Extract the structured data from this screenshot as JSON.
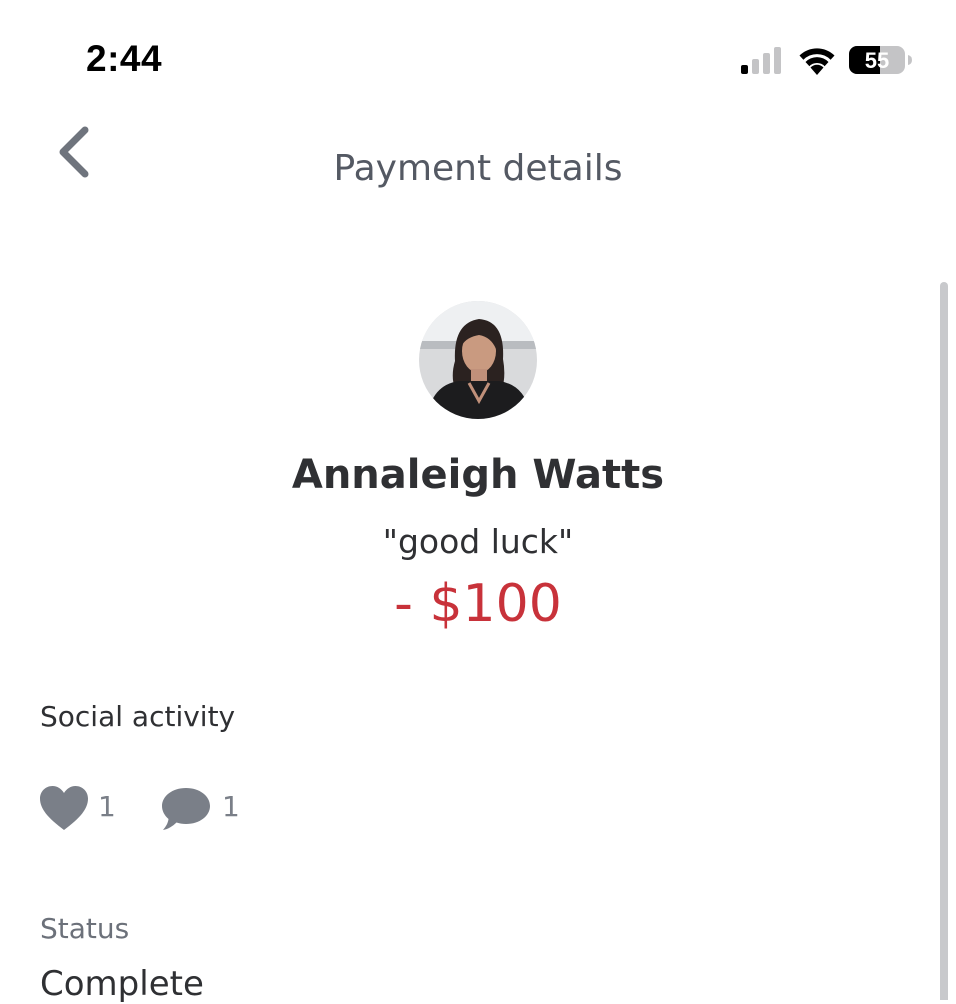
{
  "status_bar": {
    "time": "2:44",
    "battery_level": "55",
    "signal_icon": "cellular-signal-icon",
    "wifi_icon": "wifi-icon",
    "battery_icon": "battery-icon"
  },
  "header": {
    "title": "Payment details",
    "back_icon": "chevron-left-icon"
  },
  "payment": {
    "user_name": "Annaleigh Watts",
    "note": "\"good luck\"",
    "amount": "- $100",
    "amount_color": "#c8323a"
  },
  "social": {
    "label": "Social activity",
    "likes": "1",
    "comments": "1",
    "like_icon": "heart-icon",
    "comment_icon": "comment-icon"
  },
  "status": {
    "label": "Status",
    "value": "Complete"
  },
  "colors": {
    "text_primary": "#2f3033",
    "text_secondary": "#6c717a",
    "icon_gray": "#7a7f88",
    "negative_amount": "#c8323a"
  }
}
